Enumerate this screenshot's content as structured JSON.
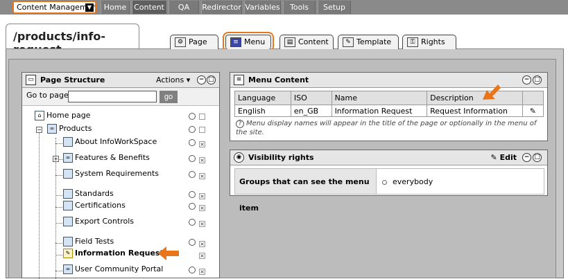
{
  "topbar": {
    "context_select": "Content Managemen",
    "nav": [
      "Home",
      "Content",
      "QA",
      "Redirector",
      "Variables",
      "Tools",
      "Setup"
    ],
    "active": "Content"
  },
  "page": {
    "path": "/products/info-request",
    "tabs": [
      "Page",
      "Menu",
      "Content",
      "Template",
      "Rights"
    ]
  },
  "structure": {
    "title": "Page Structure",
    "actions_label": "Actions",
    "goto_label": "Go to page:",
    "goto_value": "",
    "go_button": "go",
    "items": [
      "Home page",
      "Products",
      "About InfoWorkSpace",
      "Features & Benefits",
      "System Requirements",
      "Standards",
      "Certifications",
      "Export Controls",
      "Field Tests",
      "Information Request",
      "User Community Portal"
    ]
  },
  "menu_content": {
    "title": "Menu Content",
    "columns": [
      "Language",
      "ISO",
      "Name",
      "Description"
    ],
    "rows": [
      [
        "English",
        "en_GB",
        "Information Request",
        "Request Information"
      ]
    ],
    "note": "Menu display names will appear in the title of the page or optionally in the menu of the site."
  },
  "visibility": {
    "title": "Visibility rights",
    "edit_label": "Edit",
    "groups_label": "Groups that can see the menu item",
    "groups_value": "everybody"
  },
  "colors": {
    "highlight": "#e8751a",
    "topbar": "#8a8a8a",
    "panel_background": "#bcbcbc"
  }
}
